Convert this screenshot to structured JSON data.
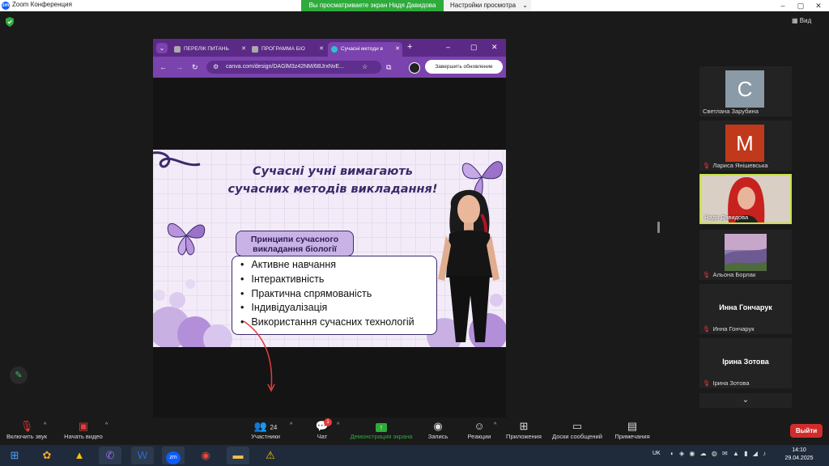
{
  "window": {
    "title": "Zoom Конференция"
  },
  "share_banner": "Вы просматриваете экран Надя Давидова",
  "view_settings": "Настройки просмотра",
  "view_label": "Вид",
  "browser": {
    "tabs": [
      {
        "label": "ПЕРЕЛІК ПИТАНЬ",
        "active": false
      },
      {
        "label": "ПРОГРАММА БІО",
        "active": false
      },
      {
        "label": "Сучасні методи в",
        "active": true
      }
    ],
    "url": "canva.com/design/DAGlM3z42NM/6BJrxNvE...",
    "update_button": "Завершить обновление"
  },
  "slide": {
    "title_line1": "Сучасні учні вимагають",
    "title_line2": "сучасних методів викладання!",
    "box_title": "Принципи сучасного викладання біології",
    "items": [
      "Активне навчання",
      "Інтерактивність",
      "Практична спрямованість",
      "Індивідуалізація",
      "Використання сучасних технологій"
    ]
  },
  "participants": [
    {
      "name": "Светлана Зарубина",
      "initial": "С",
      "color": "#8a9aa6",
      "muted": false
    },
    {
      "name": "Лариса Янішевська",
      "initial": "М",
      "color": "#c0391b",
      "muted": true
    },
    {
      "name": "Надя Давидова",
      "video": true,
      "muted": false
    },
    {
      "name": "Альона Борлак",
      "image": true,
      "muted": true
    },
    {
      "name": "Инна Гончарук",
      "big_name": "Инна Гончарук",
      "muted": true
    },
    {
      "name": "Ірина Зотова",
      "big_name": "Ірина Зотова",
      "muted": true
    }
  ],
  "toolbar": {
    "mute": "Включить звук",
    "video": "Начать видео",
    "participants": "Участники",
    "participants_count": "24",
    "chat": "Чат",
    "chat_badge": "1",
    "share": "Демонстрация экрана",
    "record": "Запись",
    "reactions": "Реакции",
    "apps": "Приложения",
    "whiteboards": "Доски сообщений",
    "notes": "Примечания",
    "leave": "Выйти"
  },
  "taskbar": {
    "language": "UK",
    "time": "14:10",
    "date": "29.04.2025"
  },
  "colors": {
    "accent_green": "#2dab3b",
    "browser_purple": "#7a43ad",
    "leave_red": "#d12c2c"
  }
}
